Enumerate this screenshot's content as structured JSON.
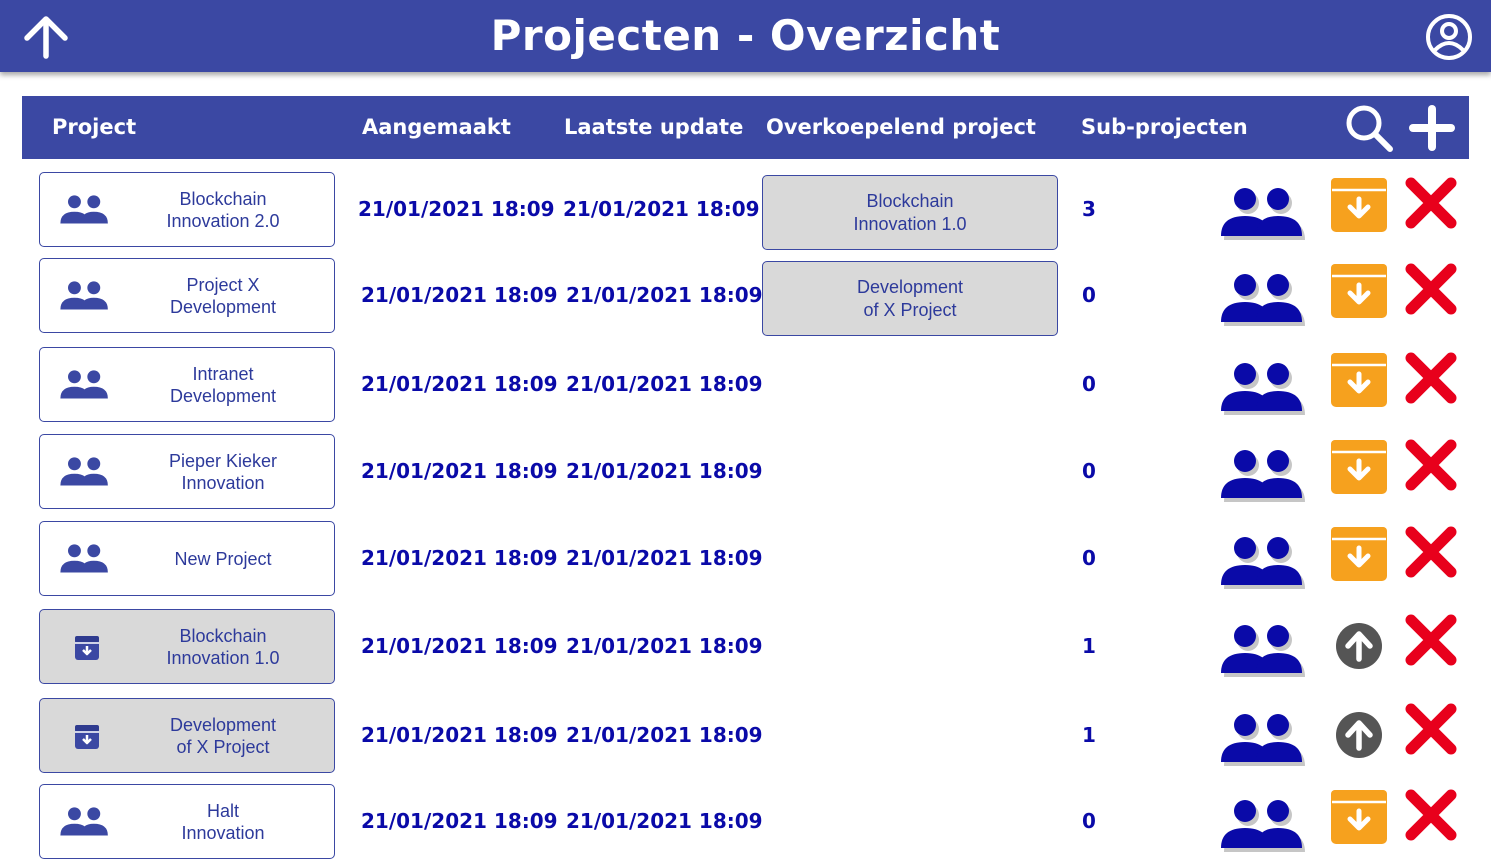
{
  "header": {
    "title": "Projecten - Overzicht",
    "back_icon": "arrow-up-icon",
    "user_icon": "user-circle-icon",
    "color": "#3b48a3"
  },
  "table": {
    "columns": [
      "Project",
      "Aangemaakt",
      "Laatste update",
      "Overkoepelend project",
      "Sub-projecten"
    ],
    "search_icon": "search-icon",
    "add_icon": "plus-icon",
    "rows": [
      {
        "name": "Blockchain\nInnovation 2.0",
        "created": "21/01/2021 18:09",
        "updated": "21/01/2021 18:09",
        "parent": "Blockchain\nInnovation 1.0",
        "subprojects": "3",
        "archived": false
      },
      {
        "name": "Project X\nDevelopment",
        "created": "21/01/2021 18:09",
        "updated": "21/01/2021 18:09",
        "parent": "Development\nof X Project",
        "subprojects": "0",
        "archived": false
      },
      {
        "name": "Intranet\nDevelopment",
        "created": "21/01/2021 18:09",
        "updated": "21/01/2021 18:09",
        "parent": "",
        "subprojects": "0",
        "archived": false
      },
      {
        "name": "Pieper Kieker\nInnovation",
        "created": "21/01/2021 18:09",
        "updated": "21/01/2021 18:09",
        "parent": "",
        "subprojects": "0",
        "archived": false
      },
      {
        "name": "New Project",
        "created": "21/01/2021 18:09",
        "updated": "21/01/2021 18:09",
        "parent": "",
        "subprojects": "0",
        "archived": false
      },
      {
        "name": "Blockchain\nInnovation 1.0",
        "created": "21/01/2021 18:09",
        "updated": "21/01/2021 18:09",
        "parent": "",
        "subprojects": "1",
        "archived": true
      },
      {
        "name": "Development\nof X Project",
        "created": "21/01/2021 18:09",
        "updated": "21/01/2021 18:09",
        "parent": "",
        "subprojects": "1",
        "archived": true
      },
      {
        "name": "Halt\nInnovation",
        "created": "21/01/2021 18:09",
        "updated": "21/01/2021 18:09",
        "parent": "",
        "subprojects": "0",
        "archived": false
      }
    ]
  },
  "colors": {
    "accent": "#3b48a3",
    "icon_blue": "#0a0aa8",
    "archive_orange": "#f6a11e",
    "delete_red": "#e8001c",
    "restore_gray": "#555555",
    "archived_bg": "#d9d9d9"
  }
}
